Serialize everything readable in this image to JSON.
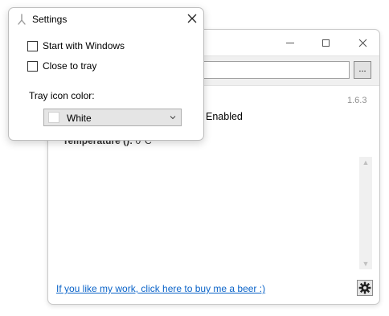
{
  "main_window": {
    "version": "1.6.3",
    "status_text": "Enabled",
    "temperature_label": "Temperature ():",
    "temperature_value": "0°C",
    "browse_label": "...",
    "link_text": "If you like my work, click here to buy me a beer :)",
    "link_color": "#0a63c8",
    "icons": {
      "minimize": "minimize-icon",
      "maximize": "maximize-icon",
      "close": "close-icon",
      "settings": "gear-icon",
      "scroll_up": "chevron-up-icon",
      "scroll_down": "chevron-down-icon"
    }
  },
  "settings": {
    "title": "Settings",
    "start_with_windows_label": "Start with Windows",
    "start_with_windows_checked": false,
    "close_to_tray_label": "Close to tray",
    "close_to_tray_checked": false,
    "tray_icon_color_label": "Tray icon color:",
    "tray_icon_color_value": "White",
    "tray_icon_swatch_color": "#ffffff",
    "icons": {
      "title": "app-icon",
      "close": "close-icon",
      "dropdown": "chevron-down-icon"
    }
  }
}
